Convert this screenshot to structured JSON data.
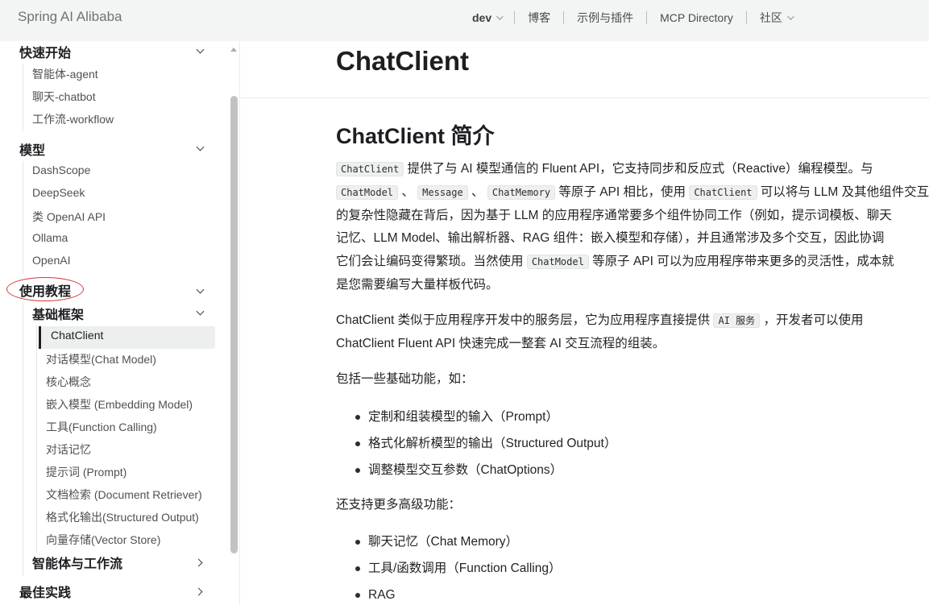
{
  "navbar": {
    "brand": "Spring AI Alibaba",
    "version": "dev",
    "items": [
      "博客",
      "示例与插件",
      "MCP Directory",
      "社区"
    ]
  },
  "sidebar": {
    "quickstart": {
      "title": "快速开始",
      "items": [
        "智能体-agent",
        "聊天-chatbot",
        "工作流-workflow"
      ]
    },
    "models": {
      "title": "模型",
      "items": [
        "DashScope",
        "DeepSeek",
        "类 OpenAI API",
        "Ollama",
        "OpenAI"
      ]
    },
    "tutorial": {
      "title": "使用教程",
      "basic": {
        "title": "基础框架",
        "items": [
          "ChatClient",
          "对话模型(Chat Model)",
          "核心概念",
          "嵌入模型 (Embedding Model)",
          "工具(Function Calling)",
          "对话记忆",
          "提示词 (Prompt)",
          "文档检索 (Document Retriever)",
          "格式化输出(Structured Output)",
          "向量存储(Vector Store)"
        ]
      },
      "agents": "智能体与工作流"
    },
    "best_practice": "最佳实践"
  },
  "content": {
    "page_title": "ChatClient",
    "intro_heading": "ChatClient 简介",
    "p1": {
      "l1_code": "ChatClient",
      "l1_text": " 提供了与 AI 模型通信的 Fluent API，它支持同步和反应式（Reactive）编程模型。与",
      "l2_code1": "ChatModel",
      "l2_sep1": " 、 ",
      "l2_code2": "Message",
      "l2_sep2": " 、 ",
      "l2_code3": "ChatMemory",
      "l2_text1": " 等原子 API 相比，使用 ",
      "l2_code4": "ChatClient",
      "l2_text2": " 可以将与 LLM 及其他组件交互",
      "l3": "的复杂性隐藏在背后，因为基于 LLM 的应用程序通常要多个组件协同工作（例如，提示词模板、聊天",
      "l4": "记忆、LLM Model、输出解析器、RAG 组件：嵌入模型和存储），并且通常涉及多个交互，因此协调",
      "l5_text1": "它们会让编码变得繁琐。当然使用 ",
      "l5_code": "ChatModel",
      "l5_text2": " 等原子 API 可以为应用程序带来更多的灵活性，成本就",
      "l6": "是您需要编写大量样板代码。"
    },
    "p2": {
      "l1_text1": "ChatClient 类似于应用程序开发中的服务层，它为应用程序直接提供 ",
      "l1_code": "AI 服务",
      "l1_text2": " ，开发者可以使用",
      "l2": "ChatClient Fluent API 快速完成一整套 AI 交互流程的组装。"
    },
    "p3": "包括一些基础功能，如：",
    "basic_features": [
      "定制和组装模型的输入（Prompt）",
      "格式化解析模型的输出（Structured Output）",
      "调整模型交互参数（ChatOptions）"
    ],
    "p4": "还支持更多高级功能：",
    "advanced_features": [
      "聊天记忆（Chat Memory）",
      "工具/函数调用（Function Calling）",
      "RAG"
    ]
  },
  "icons": {
    "chevron_down": "chevron-down-icon",
    "chevron_right": "chevron-right-icon",
    "bullet": "bullet-icon"
  },
  "colors": {
    "navbar_bg": "#f3f5f4",
    "active_bg": "#ecefed",
    "highlight_ring": "#d33a3a"
  }
}
